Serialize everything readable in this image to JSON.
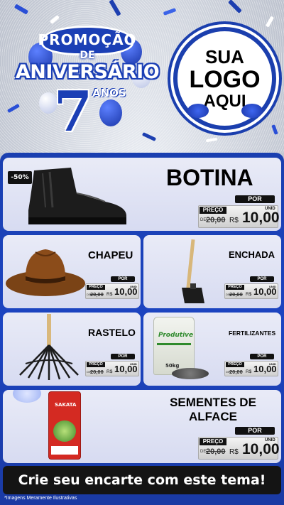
{
  "header": {
    "promo_word": "PROMOÇÃO",
    "de_word": "DE",
    "aniversario_word": "ANIVERSÁRIO",
    "number": "7",
    "anos_word": "ANOS",
    "logo": {
      "line1": "SUA",
      "line2": "LOGO",
      "line3": "AQUI"
    }
  },
  "featured": {
    "discount_badge": "-50%",
    "title": "BOTINA",
    "price": {
      "por": "POR",
      "preco": "PREÇO",
      "de": "DE",
      "old": "20,00",
      "currency": "R$",
      "value": "10,00",
      "unit": "UNID"
    }
  },
  "products": [
    {
      "title": "CHAPEU",
      "price": {
        "por": "POR",
        "preco": "PREÇO",
        "de": "DE",
        "old": "20,00",
        "currency": "R$",
        "value": "10,00",
        "unit": "UNID"
      }
    },
    {
      "title": "ENCHADA",
      "price": {
        "por": "POR",
        "preco": "PREÇO",
        "de": "DE",
        "old": "20,00",
        "currency": "R$",
        "value": "10,00",
        "unit": "UNID"
      }
    },
    {
      "title": "RASTELO",
      "price": {
        "por": "POR",
        "preco": "PREÇO",
        "de": "DE",
        "old": "20,00",
        "currency": "R$",
        "value": "10,00",
        "unit": "UNID"
      }
    },
    {
      "title": "FERTILIZANTES",
      "bag_label": "Produtive",
      "bag_weight": "50kg",
      "price": {
        "por": "POR",
        "preco": "PREÇO",
        "de": "DE",
        "old": "20,00",
        "currency": "R$",
        "value": "10,00",
        "unit": "UNID"
      }
    }
  ],
  "seeds": {
    "title_line1": "SEMENTES DE",
    "title_line2": "ALFACE",
    "pack_brand": "SAKATA",
    "price": {
      "por": "POR",
      "preco": "PREÇO",
      "de": "DE",
      "old": "20,00",
      "currency": "R$",
      "value": "10,00",
      "unit": "UNID"
    }
  },
  "footer": {
    "banner": "Crie seu encarte com este tema!",
    "note": "*Imagens Meramente Ilustrativas"
  },
  "colors": {
    "panel_blue": "#1c45c2",
    "card_bg": "#e3e6f5",
    "tag_black": "#111111"
  }
}
